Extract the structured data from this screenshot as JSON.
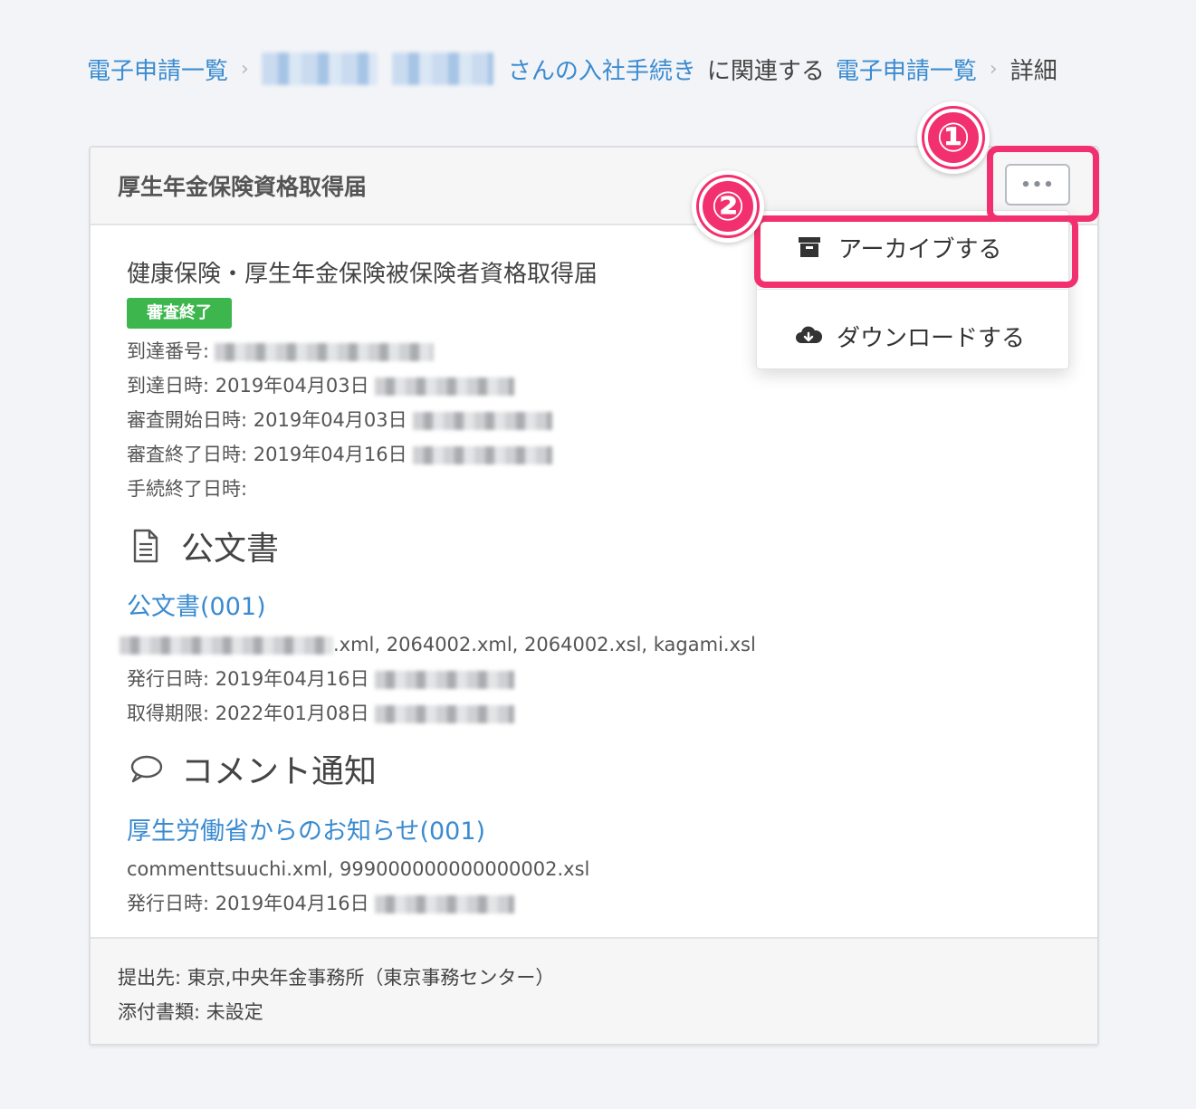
{
  "breadcrumb": {
    "root": "電子申請一覧",
    "procedure": "さんの入社手続き",
    "related": "に関連する",
    "list": "電子申請一覧",
    "current": "詳細",
    "separator": "›"
  },
  "card": {
    "header_title": "厚生年金保険資格取得届",
    "doc_title": "健康保険・厚生年金保険被保険者資格取得届",
    "status_badge": "審査終了",
    "status_color": "#3cb64d",
    "meta": {
      "arrival_number": "到達番号:",
      "arrival_datetime": "到達日時: 2019年04月03日",
      "review_start": "審査開始日時: 2019年04月03日",
      "review_end": "審査終了日時: 2019年04月16日",
      "procedure_end": "手続終了日時:"
    },
    "official_section": {
      "title": "公文書",
      "icon": "document-icon",
      "link": "公文書(001)",
      "files": ".xml, 2064002.xml, 2064002.xsl, kagami.xsl",
      "issue_date": "発行日時: 2019年04月16日",
      "expiry": "取得期限: 2022年01月08日"
    },
    "comment_section": {
      "title": "コメント通知",
      "icon": "speech-bubble-icon",
      "link": "厚生労働省からのお知らせ(001)",
      "files": "commenttsuuchi.xml, 999000000000000002.xsl",
      "issue_date": "発行日時: 2019年04月16日"
    },
    "footer": {
      "submit_to": "提出先: 東京,中央年金事務所（東京事務センター）",
      "attachments": "添付書類: 未設定"
    }
  },
  "actions": {
    "more_label": "•••",
    "archive": "アーカイブする",
    "download": "ダウンロードする"
  },
  "annotations": {
    "step1": "①",
    "step2": "②",
    "highlight_color": "#f2306f"
  }
}
